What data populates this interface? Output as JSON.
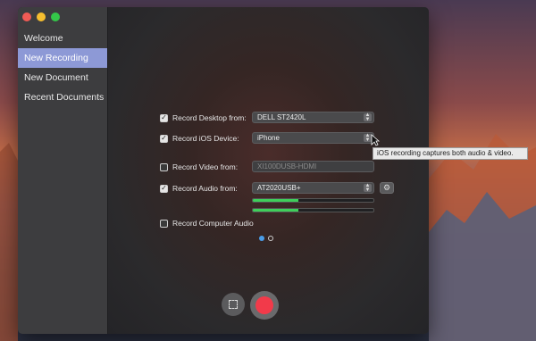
{
  "sidebar": {
    "items": [
      {
        "label": "Welcome"
      },
      {
        "label": "New Recording"
      },
      {
        "label": "New Document"
      },
      {
        "label": "Recent Documents"
      }
    ]
  },
  "recording": {
    "desktop": {
      "label": "Record Desktop from:",
      "checked": true,
      "value": "DELL ST2420L"
    },
    "ios": {
      "label": "Record iOS Device:",
      "checked": true,
      "value": "iPhone"
    },
    "video": {
      "label": "Record Video from:",
      "checked": false,
      "value": "XI100DUSB-HDMI"
    },
    "audio": {
      "label": "Record Audio from:",
      "checked": true,
      "value": "AT2020USB+"
    },
    "computer_audio": {
      "label": "Record Computer Audio",
      "checked": false
    },
    "audio_levels": [
      0.38,
      0.38
    ]
  },
  "tooltip": {
    "text": "iOS recording captures both audio & video."
  },
  "pager": {
    "pages": 2,
    "current": 1
  },
  "icons": {
    "gear": "gear-icon",
    "area": "screen-area-icon",
    "record": "record-icon"
  },
  "colors": {
    "accent": "#8d99d6",
    "record": "#f23a4a",
    "meter": "#3fcf5a",
    "page_dot": "#4a9de8"
  }
}
